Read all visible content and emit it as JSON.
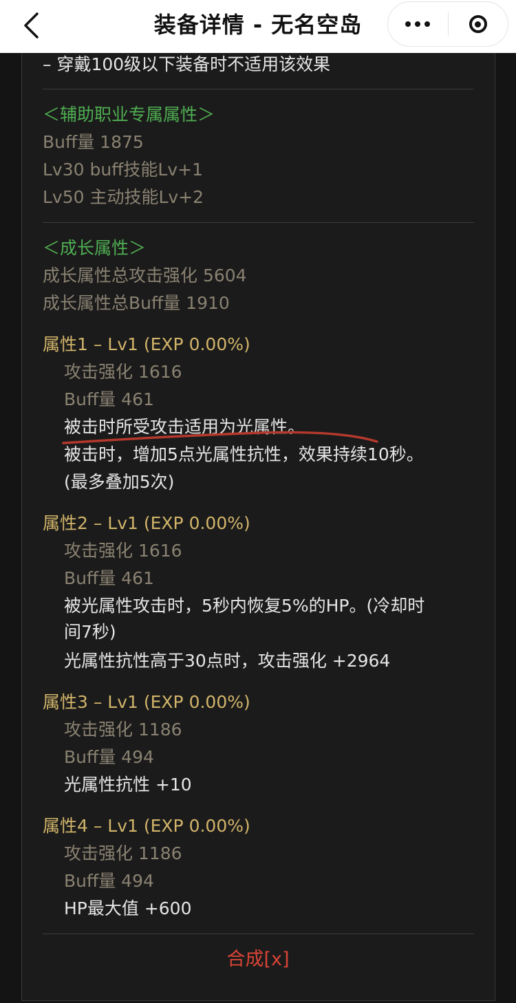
{
  "navbar": {
    "title": "装备详情 - 无名空岛"
  },
  "top_note": "– 穿戴100级以下装备时不适用该效果",
  "support": {
    "heading": "＜辅助职业专属属性＞",
    "lines": [
      "Buff量   1875",
      "Lv30 buff技能Lv+1",
      "Lv50 主动技能Lv+2"
    ]
  },
  "growth": {
    "heading": "＜成长属性＞",
    "totals": [
      "成长属性总攻击强化 5604",
      "成长属性总Buff量 1910"
    ]
  },
  "attrs": [
    {
      "title": "属性1 – Lv1 (EXP 0.00%)",
      "atk": "攻击强化   1616",
      "buff": "Buff量   461",
      "effects": [
        "被击时所受攻击适用为光属性。",
        "被击时，增加5点光属性抗性，效果持续10秒。",
        "(最多叠加5次)"
      ]
    },
    {
      "title": "属性2 – Lv1 (EXP 0.00%)",
      "atk": "攻击强化   1616",
      "buff": "Buff量   461",
      "effects": [
        "被光属性攻击时，5秒内恢复5%的HP。(冷却时",
        "间7秒)",
        "光属性抗性高于30点时，攻击强化 +2964"
      ]
    },
    {
      "title": "属性3 – Lv1 (EXP 0.00%)",
      "atk": "攻击强化   1186",
      "buff": "Buff量   494",
      "effects": [
        "光属性抗性 +10"
      ]
    },
    {
      "title": "属性4 – Lv1 (EXP 0.00%)",
      "atk": "攻击强化   1186",
      "buff": "Buff量   494",
      "effects": [
        "HP最大值 +600"
      ]
    }
  ],
  "compose_label": "合成[x]",
  "colors": {
    "background": "#141414",
    "heading_green": "#4fae52",
    "attr_gold": "#d2b56a",
    "muted": "#8a8272",
    "accent_red": "#d94436"
  }
}
